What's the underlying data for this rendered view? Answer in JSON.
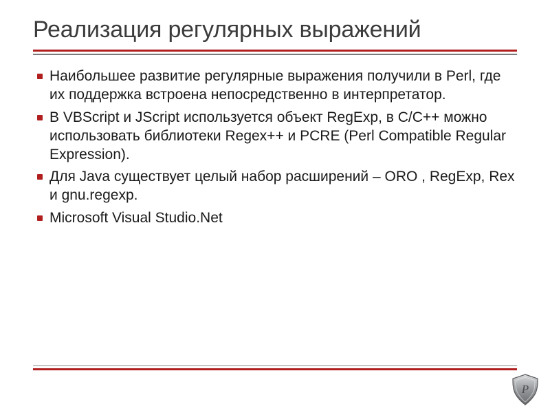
{
  "slide": {
    "title": "Реализация регулярных выражений",
    "bullets": [
      "Наибольшее развитие регулярные выражения получили в Perl, где их поддержка встроена непосредственно в интерпретатор.",
      "В VBScript и JScript используется объект RegExp, в C/C++ можно использовать библиотеки Regex++ и PCRE (Perl Compatible Regular Expression).",
      "Для Java существует целый набор расширений – ORO , RegExp, Rex и gnu.regexp.",
      "Microsoft Visual Studio.Net"
    ]
  },
  "theme": {
    "accent": "#b01e1e",
    "text": "#1a1a1a"
  },
  "badge": {
    "name": "shield-logo"
  }
}
